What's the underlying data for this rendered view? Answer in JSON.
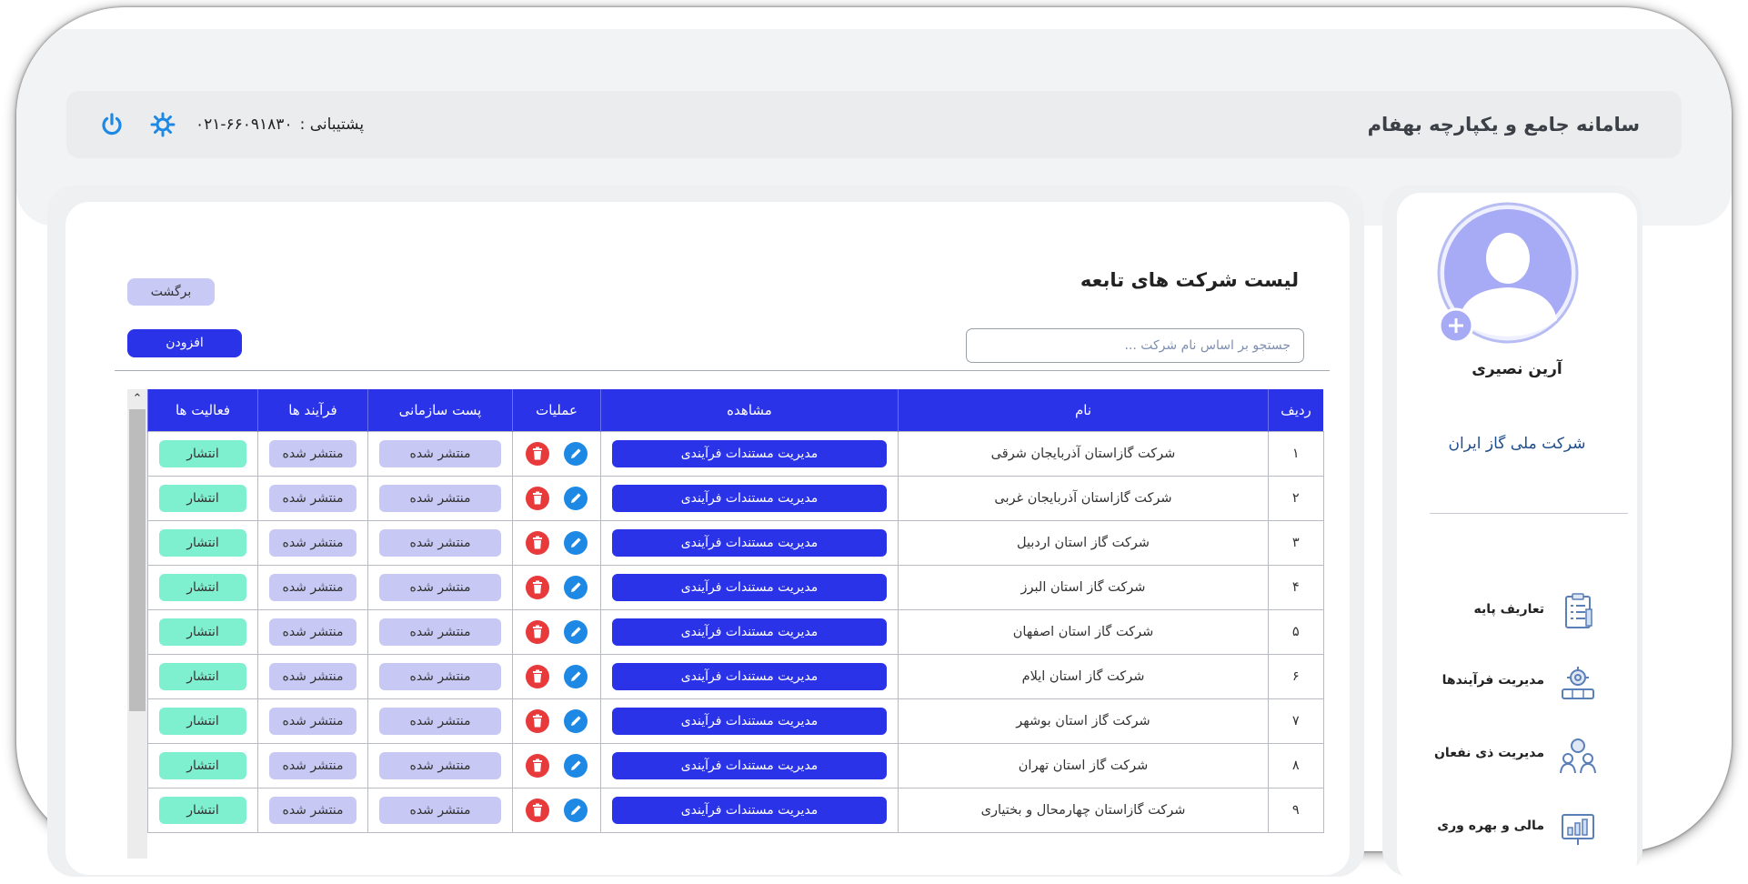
{
  "header": {
    "app_title": "سامانه جامع و یکپارچه بهفام",
    "support_label": "پشتیبانی :",
    "support_phone": "۰۲۱-۶۶۰۹۱۸۳۰"
  },
  "sidebar": {
    "user_name": "آرین نصیری",
    "organization": "شرکت ملی گاز ایران",
    "menu": [
      {
        "label": "تعاریف پایه",
        "icon": "checklist-icon"
      },
      {
        "label": "مدیریت فرآیندها",
        "icon": "process-gears-icon"
      },
      {
        "label": "مدیریت ذی نفعان",
        "icon": "stakeholders-icon"
      },
      {
        "label": "مالی و بهره وری",
        "icon": "finance-chart-icon"
      }
    ]
  },
  "page": {
    "title": "لیست شرکت های تابعه",
    "back_label": "برگشت",
    "add_label": "افزودن",
    "search_placeholder": "جستجو بر اساس نام شرکت ..."
  },
  "table": {
    "headers": {
      "row": "ردیف",
      "name": "نام",
      "view": "مشاهده",
      "ops": "عملیات",
      "post": "پست سازمانی",
      "process": "فرآیند ها",
      "activity": "فعالیت ها"
    },
    "view_button": "مدیریت مستندات فرآیندی",
    "published_label": "منتشر شده",
    "publish_label": "انتشار",
    "rows": [
      {
        "num": "۱",
        "name": "شرکت گازاستان آذربایجان شرقی"
      },
      {
        "num": "۲",
        "name": "شرکت گازاستان آذربایجان غربی"
      },
      {
        "num": "۳",
        "name": "شرکت گاز استان اردبیل"
      },
      {
        "num": "۴",
        "name": "شرکت گاز استان البرز"
      },
      {
        "num": "۵",
        "name": "شرکت گاز استان اصفهان"
      },
      {
        "num": "۶",
        "name": "شرکت گاز استان ایلام"
      },
      {
        "num": "۷",
        "name": "شرکت گاز استان بوشهر"
      },
      {
        "num": "۸",
        "name": "شرکت گاز استان تهران"
      },
      {
        "num": "۹",
        "name": "شرکت گازاستان چهارمحال و بختیاری"
      }
    ]
  },
  "colors": {
    "primary": "#2b33e8",
    "chip_gray": "#c7c8f4",
    "chip_green": "#7ff0cf",
    "delete_red": "#e8393b",
    "edit_blue": "#1e88e5",
    "org_text": "#1f4e8c"
  }
}
